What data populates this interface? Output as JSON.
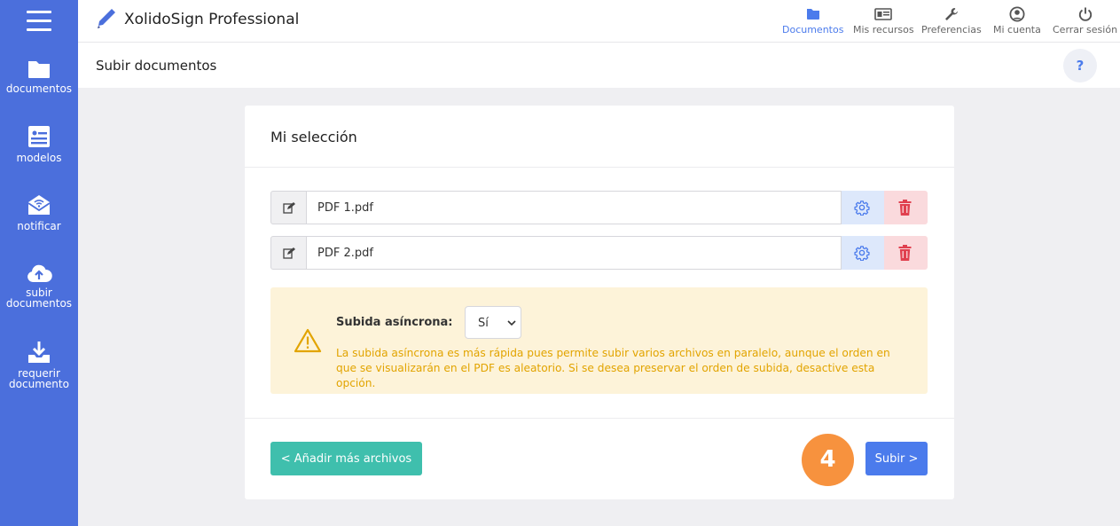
{
  "app": {
    "title": "XolidoSign Professional"
  },
  "sidebar": {
    "items": [
      {
        "label": "documentos",
        "icon": "folder-icon"
      },
      {
        "label": "modelos",
        "icon": "template-icon"
      },
      {
        "label": "notificar",
        "icon": "envelope-icon"
      },
      {
        "label_line1": "subir",
        "label_line2": "documentos",
        "icon": "cloud-upload-icon"
      },
      {
        "label_line1": "requerir",
        "label_line2": "documento",
        "icon": "download-tray-icon"
      }
    ]
  },
  "topnav": {
    "items": [
      {
        "label": "Documentos",
        "icon": "folder-icon",
        "active": true
      },
      {
        "label": "Mis recursos",
        "icon": "id-card-icon"
      },
      {
        "label": "Preferencias",
        "icon": "wrench-icon"
      },
      {
        "label": "Mi cuenta",
        "icon": "user-circle-icon"
      },
      {
        "label": "Cerrar sesión",
        "icon": "power-icon"
      }
    ]
  },
  "page": {
    "title": "Subir documentos",
    "help": "?"
  },
  "card": {
    "title": "Mi selección",
    "files": [
      {
        "name": "PDF 1.pdf"
      },
      {
        "name": "PDF 2.pdf"
      }
    ],
    "async": {
      "label": "Subida asíncrona:",
      "value": "Sí",
      "message": "La subida asíncrona es más rápida pues permite subir varios archivos en paralelo, aunque el orden en que se visualizarán en el PDF es aleatorio. Si se desea preservar el orden de subida, desactive esta opción."
    },
    "add_more_label": "< Añadir más archivos",
    "upload_label": "Subir >",
    "step_badge": "4"
  },
  "colors": {
    "sidebar": "#4b6fdc",
    "accent": "#4b7bec",
    "teal": "#3fbfad",
    "warning_text": "#e2a400",
    "warning_bg": "#fdf3d9",
    "badge": "#f7923e",
    "danger": "#e0404f"
  }
}
